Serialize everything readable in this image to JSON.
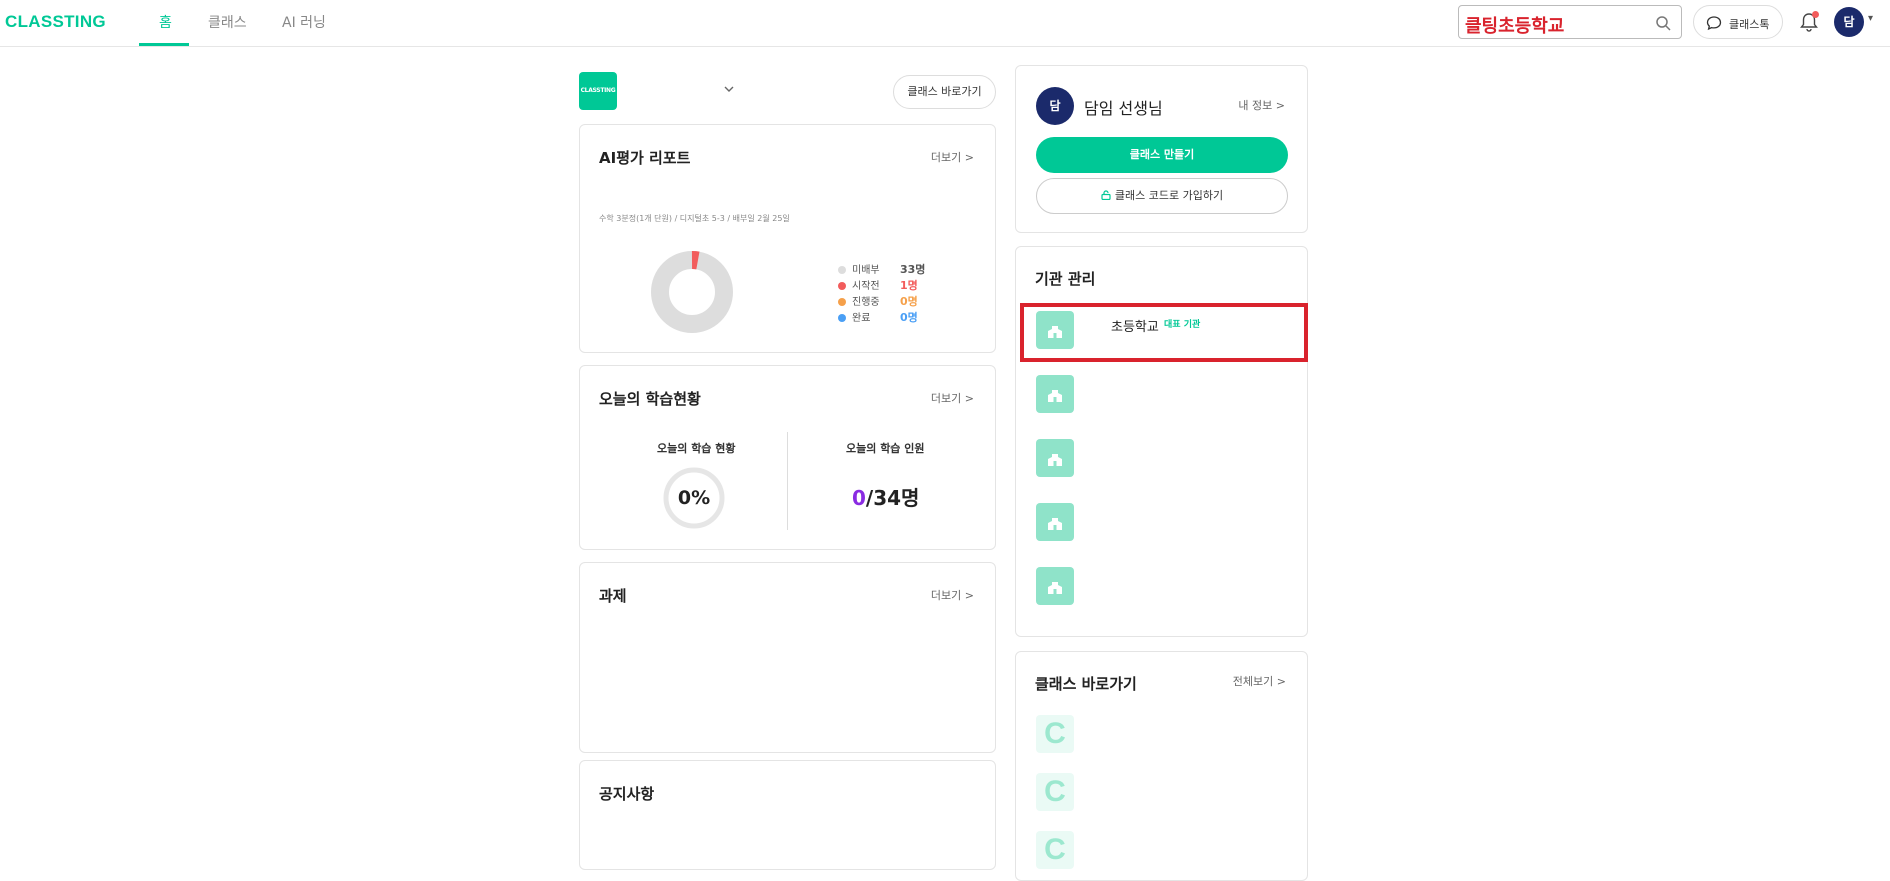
{
  "header": {
    "logo": "CLASSTING",
    "tabs": [
      {
        "label": "홈",
        "active": true
      },
      {
        "label": "클래스",
        "active": false
      },
      {
        "label": "AI 러닝",
        "active": false
      }
    ],
    "search_value": "클팅초등학교",
    "talk_label": "클래스톡",
    "avatar_initial": "담",
    "accent_color": "#00c896"
  },
  "class_selector": {
    "logo_text": "CLASSTING",
    "goto_label": "클래스 바로가기"
  },
  "ai_report": {
    "title": "AI평가 리포트",
    "more": "더보기 >",
    "subtitle": "수학 3분정(1개 단원) / 디지털초 5-3 / 배부일 2월 25일",
    "legend": [
      {
        "label": "미배부",
        "value": "33명",
        "color": "#dddddd",
        "value_color": "#555555"
      },
      {
        "label": "시작전",
        "value": "1명",
        "color": "#f25c5c",
        "value_color": "#f25c5c"
      },
      {
        "label": "진행중",
        "value": "0명",
        "color": "#f5a04a",
        "value_color": "#f5a04a"
      },
      {
        "label": "완료",
        "value": "0명",
        "color": "#4a9ff5",
        "value_color": "#4a9ff5"
      }
    ]
  },
  "today": {
    "title": "오늘의 학습현황",
    "more": "더보기 >",
    "status_label": "오늘의 학습 현황",
    "status_value": "0%",
    "count_label": "오늘의 학습 인원",
    "count_current": "0",
    "count_total": "/34명"
  },
  "assignment": {
    "title": "과제",
    "more": "더보기 >"
  },
  "notice": {
    "title": "공지사항"
  },
  "profile": {
    "avatar_initial": "담",
    "name": "담임 선생님",
    "my_info": "내 정보 >",
    "make_class": "클래스 만들기",
    "join_class": "클래스 코드로 가입하기"
  },
  "org": {
    "title": "기관 관리",
    "first_name": "초등학교",
    "first_badge": "대표 기관",
    "count": 5
  },
  "shortcuts": {
    "title": "클래스 바로가기",
    "more": "전체보기 >",
    "letter": "C"
  }
}
